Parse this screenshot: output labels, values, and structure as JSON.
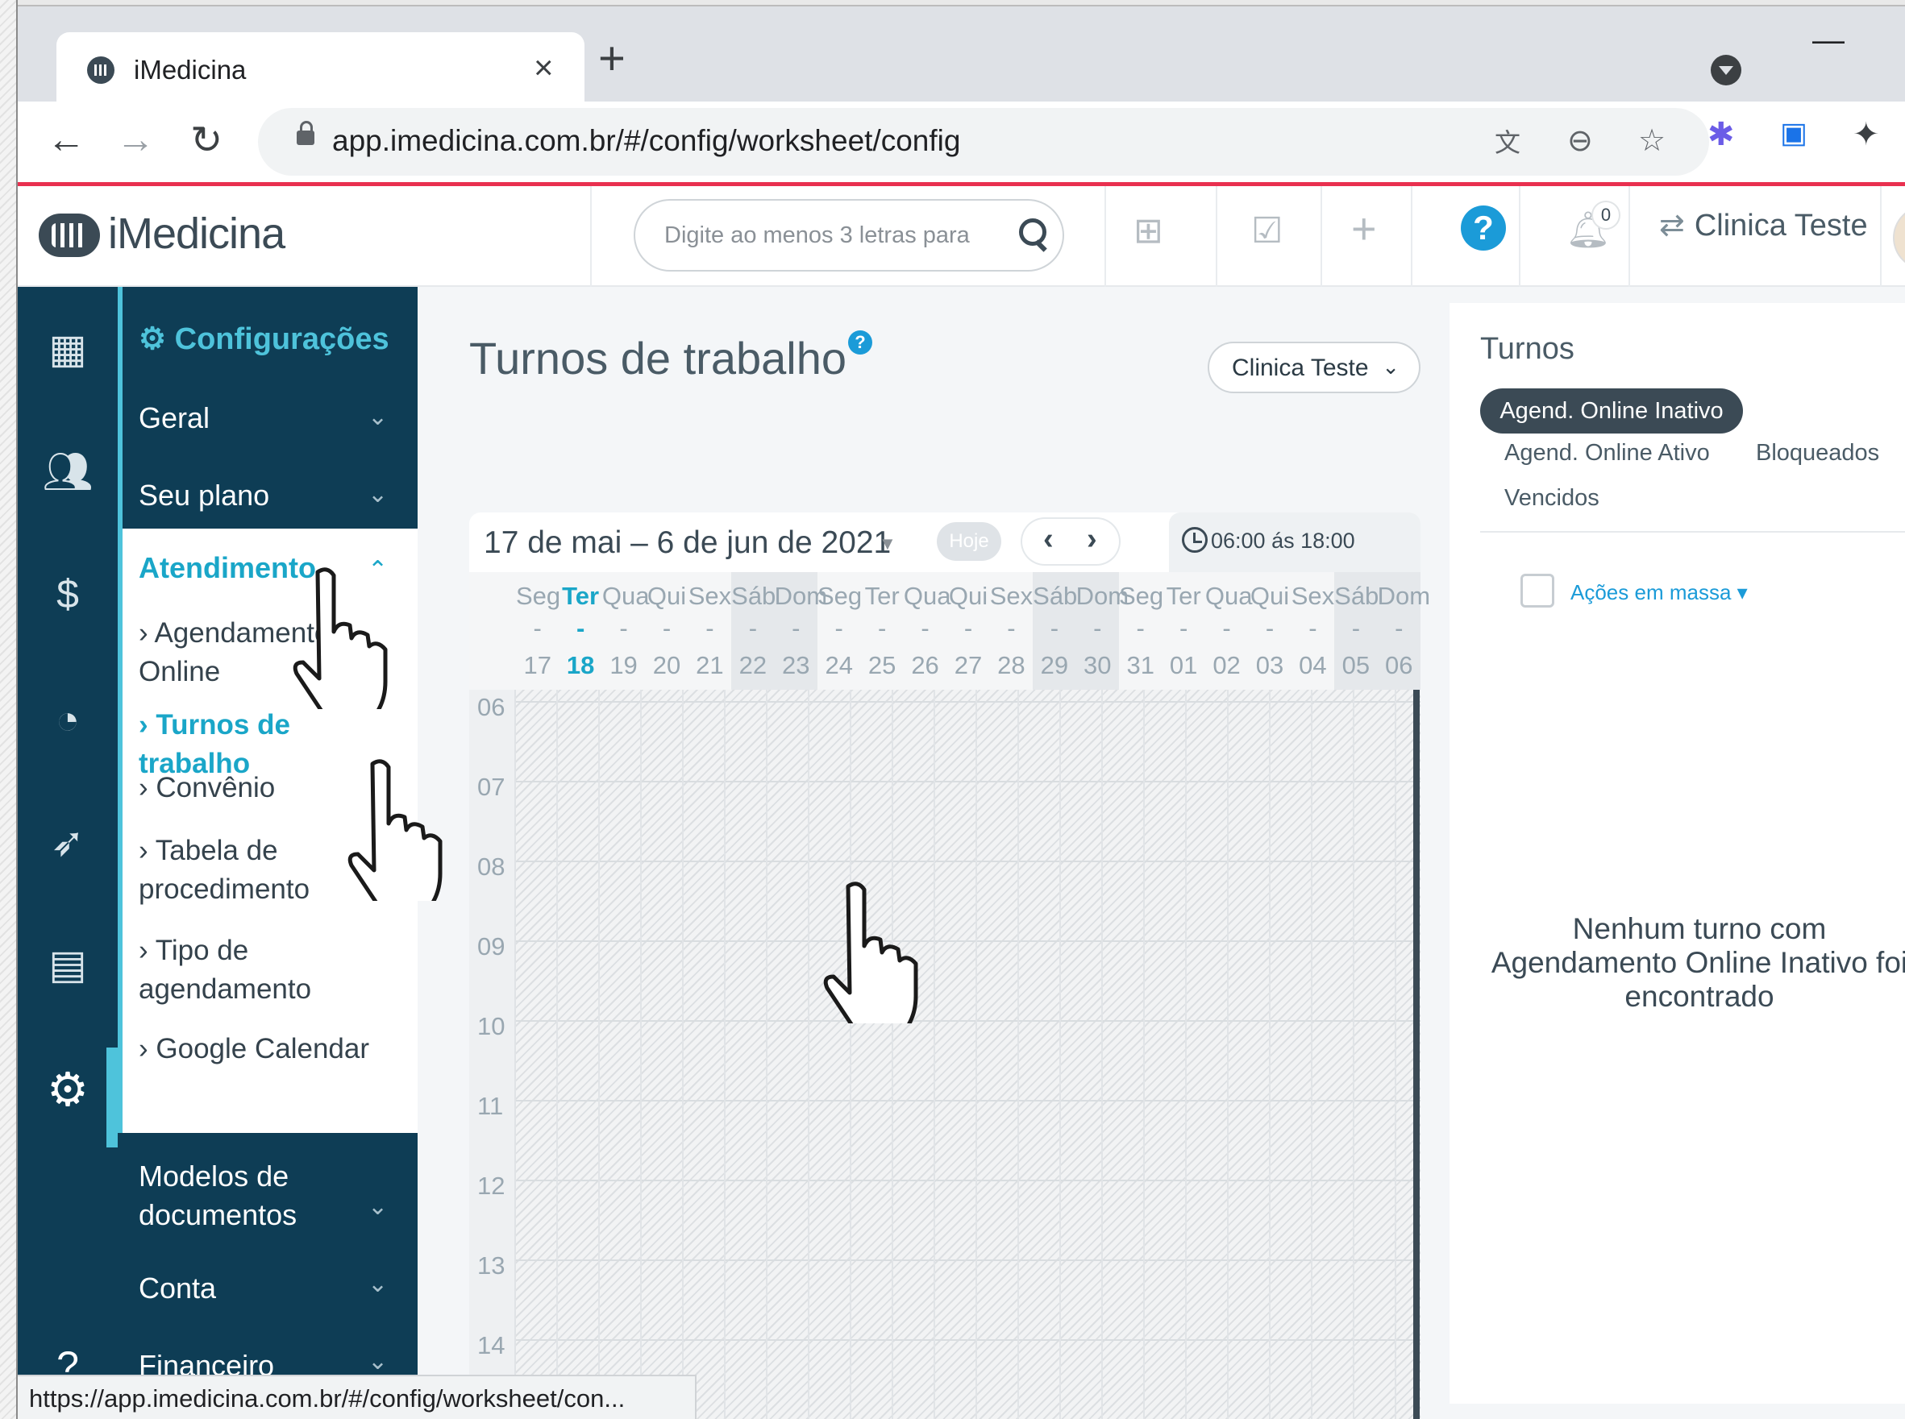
{
  "browser": {
    "tab_title": "iMedicina",
    "tab_close": "×",
    "new_tab": "+",
    "url": "app.imedicina.com.br/#/config/worksheet/config",
    "status_url": "https://app.imedicina.com.br/#/config/worksheet/con..."
  },
  "header": {
    "logo_text": "iMedicina",
    "search_placeholder": "Digite ao menos 3 letras para",
    "help_label": "?",
    "notification_count": "0",
    "clinic_name": "Clinica Teste"
  },
  "menu": {
    "title": "Configurações",
    "items": [
      {
        "label": "Geral"
      },
      {
        "label": "Seu plano"
      },
      {
        "label": "Modelos de documentos"
      },
      {
        "label": "Conta"
      },
      {
        "label": "Financeiro"
      }
    ],
    "expanded": {
      "label": "Atendimento",
      "subitems": [
        {
          "label": "› Agendamento Online"
        },
        {
          "label": "› Turnos de trabalho",
          "active": true
        },
        {
          "label": "› Convênio"
        },
        {
          "label": "› Tabela de procedimento"
        },
        {
          "label": "› Tipo de agendamento"
        },
        {
          "label": "› Google Calendar"
        }
      ]
    }
  },
  "main": {
    "title": "Turnos de trabalho",
    "help_label": "?",
    "clinic_select": "Clinica Teste",
    "calendar": {
      "date_range": "17 de mai – 6 de jun de 2021",
      "today_label": "Hoje",
      "time_range": "06:00 ás 18:00",
      "days": [
        {
          "name": "Seg",
          "date": "17"
        },
        {
          "name": "Ter",
          "date": "18",
          "today": true
        },
        {
          "name": "Qua",
          "date": "19"
        },
        {
          "name": "Qui",
          "date": "20"
        },
        {
          "name": "Sex",
          "date": "21"
        },
        {
          "name": "Sáb",
          "date": "22",
          "weekend": true
        },
        {
          "name": "Dom",
          "date": "23",
          "weekend": true
        },
        {
          "name": "Seg",
          "date": "24"
        },
        {
          "name": "Ter",
          "date": "25"
        },
        {
          "name": "Qua",
          "date": "26"
        },
        {
          "name": "Qui",
          "date": "27"
        },
        {
          "name": "Sex",
          "date": "28"
        },
        {
          "name": "Sáb",
          "date": "29",
          "weekend": true
        },
        {
          "name": "Dom",
          "date": "30",
          "weekend": true
        },
        {
          "name": "Seg",
          "date": "31"
        },
        {
          "name": "Ter",
          "date": "01"
        },
        {
          "name": "Qua",
          "date": "02"
        },
        {
          "name": "Qui",
          "date": "03"
        },
        {
          "name": "Sex",
          "date": "04"
        },
        {
          "name": "Sáb",
          "date": "05",
          "weekend": true
        },
        {
          "name": "Dom",
          "date": "06",
          "weekend": true
        }
      ],
      "hours": [
        "06",
        "07",
        "08",
        "09",
        "10",
        "11",
        "12",
        "13",
        "14"
      ]
    }
  },
  "panel": {
    "title": "Turnos",
    "filters": [
      "Agend. Online Inativo",
      "Agend. Online Ativo",
      "Bloqueados",
      "Vencidos"
    ],
    "active_filter": "Agend. Online Inativo",
    "bulk_actions": "Ações em massa",
    "empty_message": "Nenhum turno com Agendamento Online Inativo foi encontrado"
  },
  "colors": {
    "sidebar": "#0e3d55",
    "accent": "#1aa6c8",
    "brand_line": "#e9304f"
  }
}
